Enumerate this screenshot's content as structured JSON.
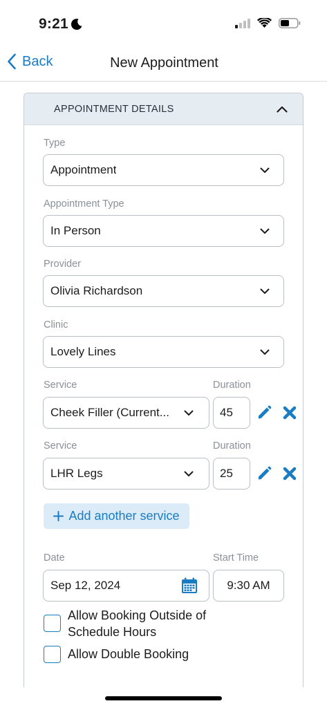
{
  "status_bar": {
    "time": "9:21"
  },
  "nav": {
    "back_label": "Back",
    "title": "New Appointment"
  },
  "section": {
    "title": "APPOINTMENT DETAILS"
  },
  "fields": {
    "type": {
      "label": "Type",
      "value": "Appointment"
    },
    "appointment_type": {
      "label": "Appointment Type",
      "value": "In Person"
    },
    "provider": {
      "label": "Provider",
      "value": "Olivia Richardson"
    },
    "clinic": {
      "label": "Clinic",
      "value": "Lovely Lines"
    }
  },
  "services": [
    {
      "service_label": "Service",
      "duration_label": "Duration",
      "value": "Cheek Filler (Current...",
      "duration": "45"
    },
    {
      "service_label": "Service",
      "duration_label": "Duration",
      "value": "LHR Legs",
      "duration": "25"
    }
  ],
  "add_service_label": "Add another service",
  "date": {
    "label": "Date",
    "value": "Sep 12, 2024"
  },
  "start_time": {
    "label": "Start Time",
    "value": "9:30 AM"
  },
  "checkboxes": [
    {
      "line1": "Allow Booking Outside of",
      "line2": "Schedule Hours",
      "checked": false
    },
    {
      "line1": "Allow Double Booking",
      "checked": false
    }
  ],
  "colors": {
    "accent": "#1a7dc4",
    "header_bg": "#e6edf2",
    "add_bg": "#dcebf8"
  },
  "icons": [
    "moon-icon",
    "signal-icon",
    "wifi-icon",
    "battery-icon",
    "chevron-left-icon",
    "chevron-up-icon",
    "chevron-down-icon",
    "pencil-icon",
    "close-icon",
    "plus-icon",
    "calendar-icon"
  ]
}
